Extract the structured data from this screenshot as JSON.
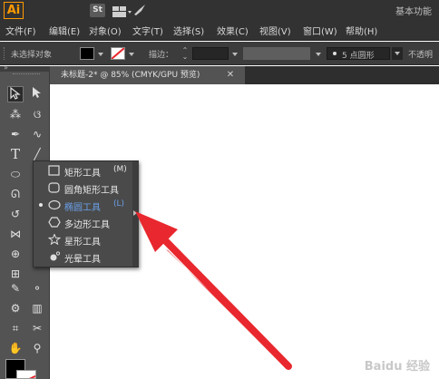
{
  "app": {
    "logo_text": "Ai",
    "st_icon": "St",
    "workspace_label": "基本功能"
  },
  "menu": {
    "items": [
      "文件(F)",
      "编辑(E)",
      "对象(O)",
      "文字(T)",
      "选择(S)",
      "效果(C)",
      "视图(V)",
      "窗口(W)",
      "帮助(H)"
    ]
  },
  "control_bar": {
    "no_selection": "未选择对象",
    "stroke_label": "描边：",
    "brush_label": "5 点圆形",
    "opacity_label": "不透明",
    "fill_color": "#000000",
    "stroke_color": "#ffffff"
  },
  "document_tab": {
    "title": "未标题-2* @ 85% (CMYK/GPU 预览)",
    "close_icon": "close-icon"
  },
  "flyout": {
    "items": [
      {
        "label": "矩形工具",
        "shortcut": "(M)",
        "icon": "rectangle-icon"
      },
      {
        "label": "圆角矩形工具",
        "shortcut": "",
        "icon": "rounded-rectangle-icon"
      },
      {
        "label": "椭圆工具",
        "shortcut": "(L)",
        "icon": "ellipse-icon"
      },
      {
        "label": "多边形工具",
        "shortcut": "",
        "icon": "polygon-icon"
      },
      {
        "label": "星形工具",
        "shortcut": "",
        "icon": "star-icon"
      },
      {
        "label": "光晕工具",
        "shortcut": "",
        "icon": "flare-icon"
      }
    ],
    "active_index": 2
  },
  "colors": {
    "arrow": "#e8282e",
    "active_item": "#6aa0e8",
    "logo": "#ff9a00"
  },
  "watermark": "Baidu 经验"
}
